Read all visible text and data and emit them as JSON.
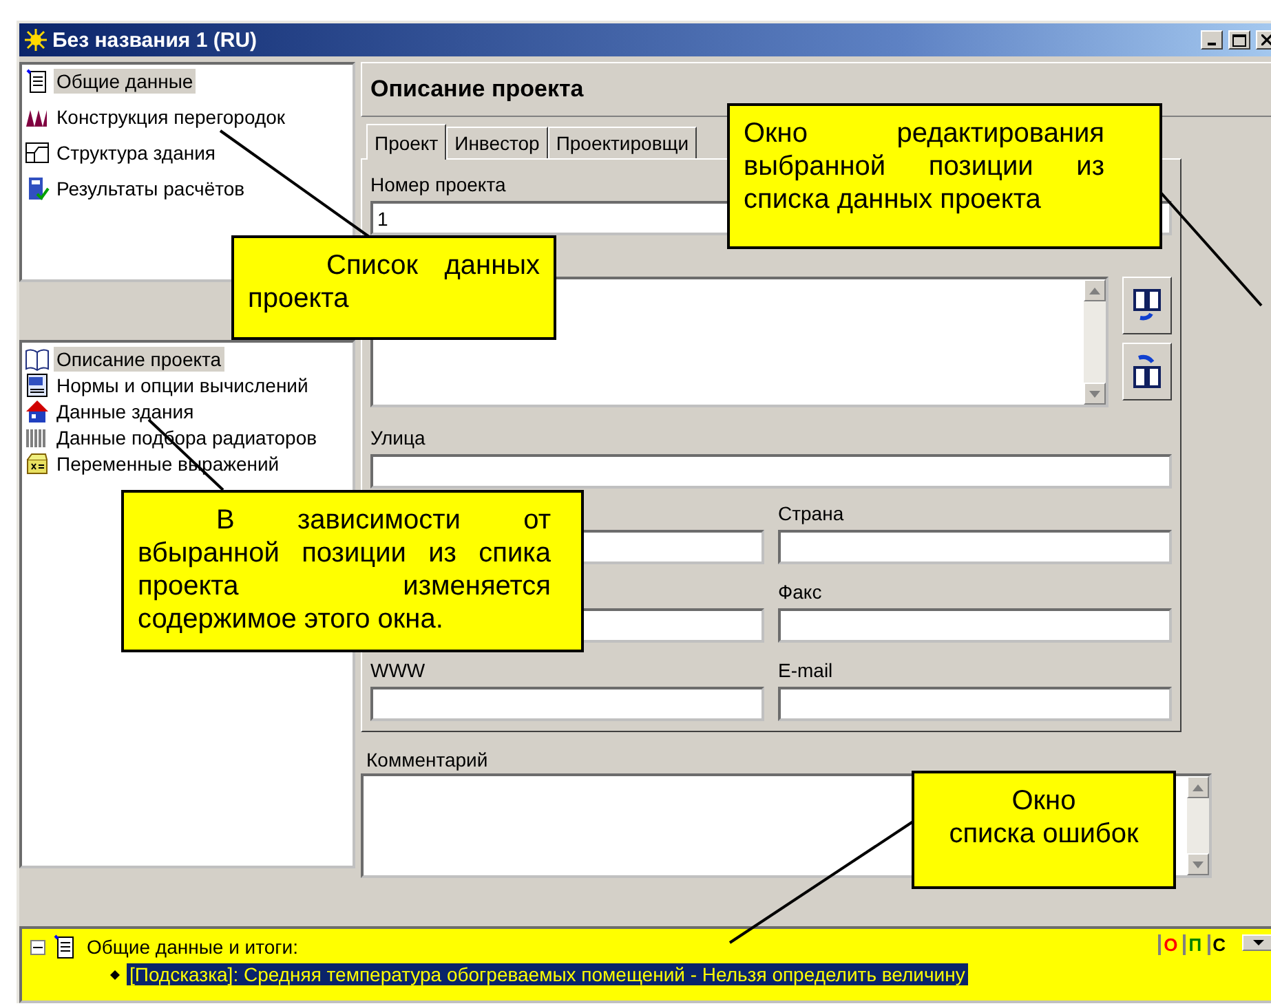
{
  "window": {
    "title": "Без названия 1 (RU)"
  },
  "project_tree": {
    "items": [
      {
        "label": "Общие данные",
        "selected": true
      },
      {
        "label": "Конструкция перегородок",
        "selected": false
      },
      {
        "label": "Структура здания",
        "selected": false
      },
      {
        "label": "Результаты расчётов",
        "selected": false
      }
    ]
  },
  "section_list": {
    "items": [
      {
        "label": "Описание проекта",
        "selected": true
      },
      {
        "label": "Нормы и опции вычислений",
        "selected": false
      },
      {
        "label": "Данные здания",
        "selected": false
      },
      {
        "label": "Данные подбора радиаторов",
        "selected": false
      },
      {
        "label": "Переменные выражений",
        "selected": false
      }
    ]
  },
  "editor": {
    "header": "Описание проекта",
    "tabs": [
      {
        "label": "Проект",
        "selected": true
      },
      {
        "label": "Инвестор",
        "selected": false
      },
      {
        "label": "Проектировщи",
        "selected": false
      }
    ],
    "project_number": {
      "label": "Номер проекта",
      "value": "1"
    },
    "street": {
      "label": "Улица"
    },
    "field_rows": [
      {
        "right_label": "Страна"
      },
      {
        "right_label": "Факс"
      },
      {
        "left_label": "WWW",
        "right_label": "E-mail"
      }
    ],
    "comment": {
      "label": "Комментарий"
    }
  },
  "error_panel": {
    "root": {
      "label": "Общие данные и итоги:",
      "expanded": true,
      "children": [
        {
          "label": "[Подсказка]: Средняя температура обогреваемых помещений - Нельзя определить величину",
          "selected": true
        }
      ]
    },
    "filters": [
      {
        "label": "О",
        "color": "#ff0000"
      },
      {
        "label": "П",
        "color": "#008000"
      },
      {
        "label": "С",
        "color": "#000000"
      }
    ]
  },
  "annotations": [
    {
      "text": "Список данных проекта"
    },
    {
      "text": "В зависимости от вбыранной позиции из спика проекта изменяется содержимое этого окна."
    },
    {
      "text": "Окно редактирования выбранной позиции из списка данных проекта"
    },
    {
      "lines": [
        "Окно",
        "списка ошибок"
      ]
    }
  ]
}
